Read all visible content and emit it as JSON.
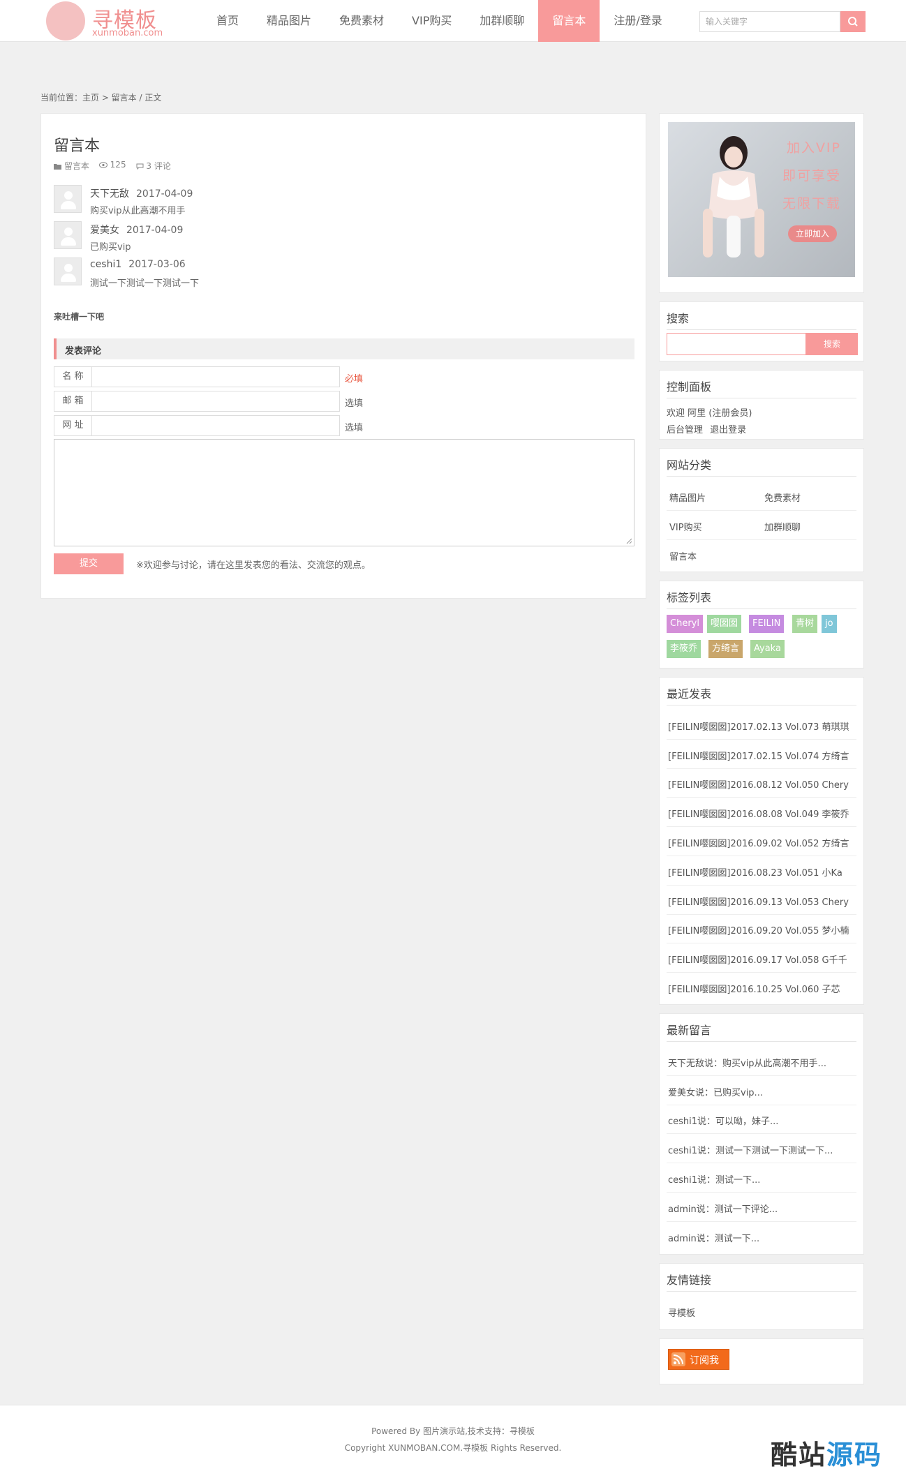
{
  "header": {
    "logo_title": "寻模板",
    "logo_sub": "xunmoban.com",
    "nav": [
      {
        "label": "首页",
        "active": false
      },
      {
        "label": "精品图片",
        "active": false
      },
      {
        "label": "免费素材",
        "active": false
      },
      {
        "label": "VIP购买",
        "active": false
      },
      {
        "label": "加群顺聊",
        "active": false
      },
      {
        "label": "留言本",
        "active": true
      },
      {
        "label": "注册/登录",
        "active": false
      }
    ],
    "search_placeholder": "输入关键字"
  },
  "breadcrumb": "当前位置：主页 > 留言本 / 正文",
  "post": {
    "title": "留言本",
    "meta_category": "留言本",
    "meta_views": "125",
    "meta_comments": "3 评论",
    "comments": [
      {
        "name": "天下无敌",
        "date": "2017-04-09",
        "text": "购买vip从此高潮不用手"
      },
      {
        "name": "爱美女",
        "date": "2017-04-09",
        "text": "已购买vip"
      },
      {
        "name": "ceshi1",
        "date": "2017-03-06",
        "text": "测试一下测试一下测试一下"
      }
    ],
    "tucao": "来吐槽一下吧",
    "form_title": "发表评论",
    "fields": [
      {
        "label": "名 称",
        "hint": "必填"
      },
      {
        "label": "邮 箱",
        "hint": "选填"
      },
      {
        "label": "网 址",
        "hint": "选填"
      }
    ],
    "submit_label": "提交",
    "submit_note": "※欢迎参与讨论，请在这里发表您的看法、交流您的观点。"
  },
  "sidebar": {
    "promo": {
      "line1": "加入VIP",
      "line2": "即可享受",
      "line3": "无限下载",
      "button": "立即加入"
    },
    "search": {
      "title": "搜索",
      "button": "搜索"
    },
    "control": {
      "title": "控制面板",
      "welcome": "欢迎 阿里 (注册会员)",
      "admin": "后台管理",
      "logout": "退出登录"
    },
    "categories": {
      "title": "网站分类",
      "items": [
        "精品图片",
        "免费素材",
        "VIP购买",
        "加群顺聊",
        "留言本"
      ]
    },
    "tags": {
      "title": "标签列表",
      "items": [
        {
          "label": "Cheryl",
          "color": "#d48ed8"
        },
        {
          "label": "嘤囡囡",
          "color": "#9fd89f"
        },
        {
          "label": "FEILIN",
          "color": "#c58be0"
        },
        {
          "label": "青树",
          "color": "#a8d89c"
        },
        {
          "label": "jo",
          "color": "#7fc6d8"
        },
        {
          "label": "李筱乔",
          "color": "#9fd89f"
        },
        {
          "label": "方绮言",
          "color": "#c9a66b"
        },
        {
          "label": "Ayaka",
          "color": "#a8d89c"
        }
      ]
    },
    "recent": {
      "title": "最近发表",
      "items": [
        "[FEILIN嘤囡囡]2017.02.13 Vol.073 萌琪琪",
        "[FEILIN嘤囡囡]2017.02.15 Vol.074 方绮言",
        "[FEILIN嘤囡囡]2016.08.12 Vol.050 Chery",
        "[FEILIN嘤囡囡]2016.08.08 Vol.049 李筱乔",
        "[FEILIN嘤囡囡]2016.09.02 Vol.052 方绮言",
        "[FEILIN嘤囡囡]2016.08.23 Vol.051 小Ka",
        "[FEILIN嘤囡囡]2016.09.13 Vol.053 Chery",
        "[FEILIN嘤囡囡]2016.09.20 Vol.055 梦小楠",
        "[FEILIN嘤囡囡]2016.09.17 Vol.058 G千千",
        "[FEILIN嘤囡囡]2016.10.25 Vol.060 子芯"
      ]
    },
    "latest_comments": {
      "title": "最新留言",
      "items": [
        "天下无敌说：购买vip从此高潮不用手...",
        "爱美女说：已购买vip...",
        "ceshi1说：可以呦，妹子...",
        "ceshi1说：测试一下测试一下测试一下...",
        "ceshi1说：测试一下...",
        "admin说：测试一下评论...",
        "admin说：测试一下..."
      ]
    },
    "links": {
      "title": "友情链接",
      "items": [
        "寻模板"
      ]
    },
    "rss": {
      "label": "订阅我"
    }
  },
  "footer": {
    "line1": "Powered By 图片演示站,技术支持：寻模板",
    "line2": "Copyright XUNMOBAN.COM.寻模板 Rights Reserved.",
    "watermark_a": "酷站",
    "watermark_b": "源码"
  },
  "colors": {
    "accent": "#f89a9a",
    "required": "#e8553e",
    "rss": "#f26a1b"
  }
}
